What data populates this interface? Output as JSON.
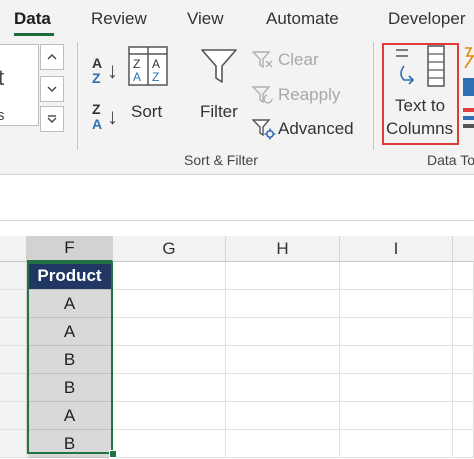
{
  "tabs": [
    {
      "label": "Data",
      "active": true
    },
    {
      "label": "Review"
    },
    {
      "label": "View"
    },
    {
      "label": "Automate"
    },
    {
      "label": "Developer"
    }
  ],
  "ribbon": {
    "left_fragment": {
      "top_char": "t",
      "bottom_text": "s"
    },
    "sort_filter": {
      "sort_az": {
        "top": "A",
        "bottom": "Z"
      },
      "sort_za": {
        "top": "Z",
        "bottom": "A"
      },
      "sort_label": "Sort",
      "filter_label": "Filter",
      "clear_label": "Clear",
      "reapply_label": "Reapply",
      "advanced_label": "Advanced",
      "group_label": "Sort & Filter"
    },
    "data_tools": {
      "text_to_columns_line1": "Text to",
      "text_to_columns_line2": "Columns",
      "group_label": "Data To"
    }
  },
  "grid": {
    "columns": [
      "F",
      "G",
      "H",
      "I"
    ],
    "selected_column": "F",
    "f_column": [
      "Product",
      "A",
      "A",
      "B",
      "B",
      "A",
      "B"
    ]
  },
  "colors": {
    "accent_green": "#217346",
    "header_cell_bg": "#203764",
    "highlight_red": "#e03c3c"
  }
}
